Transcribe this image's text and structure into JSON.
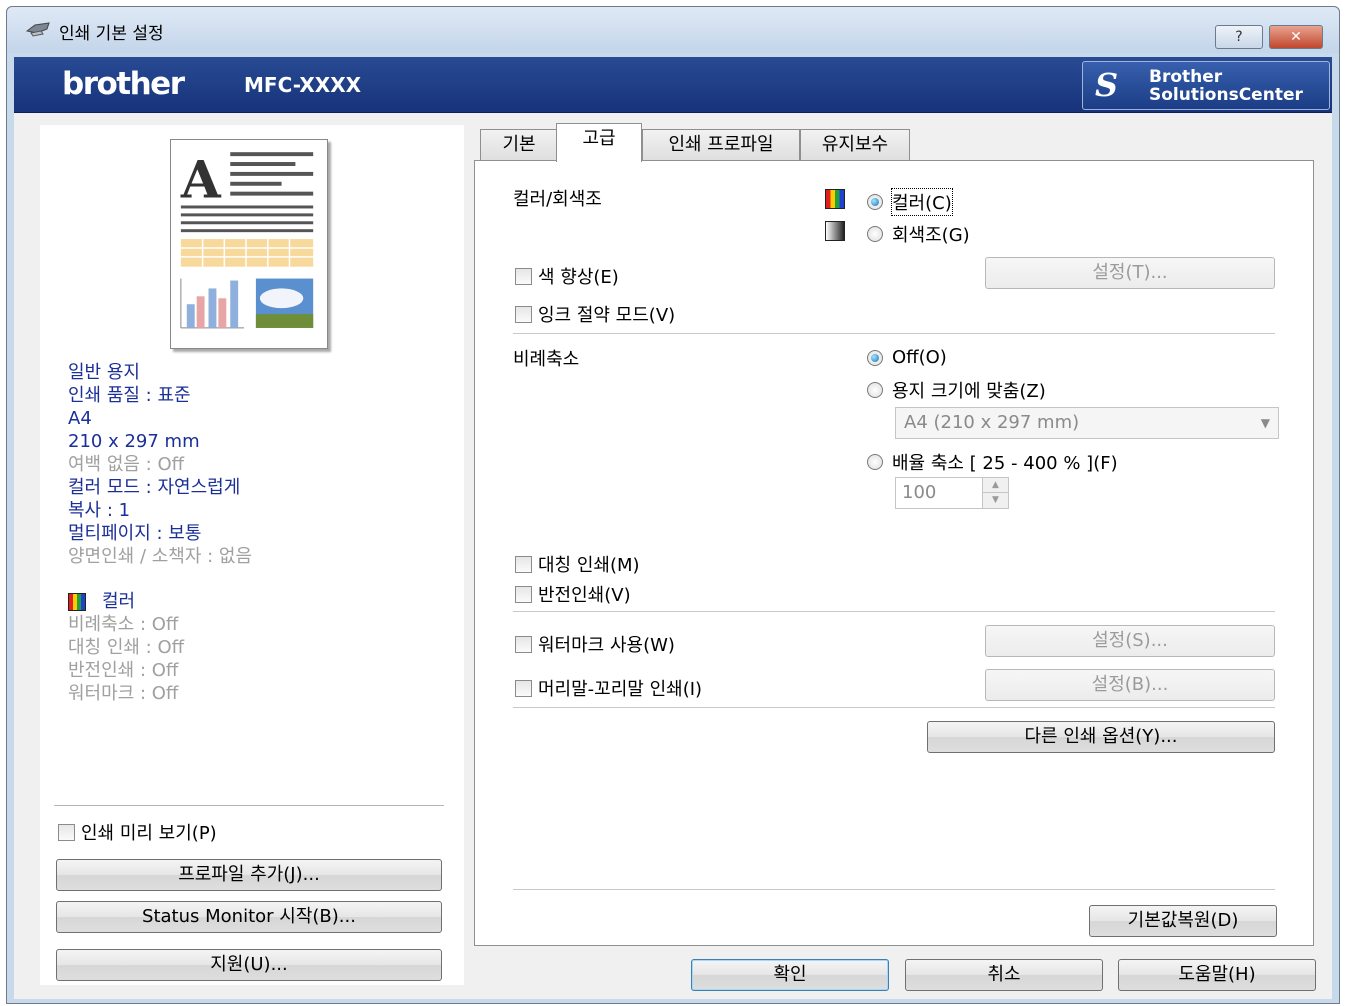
{
  "window": {
    "title": "인쇄 기본 설정",
    "help_btn": "?",
    "close_btn": "✕"
  },
  "brand": {
    "logo": "brother",
    "model": "MFC-XXXX",
    "solutions_line1": "Brother",
    "solutions_line2": "SolutionsCenter"
  },
  "summary": {
    "lines": [
      {
        "text": "일반 용지",
        "style": "blue"
      },
      {
        "text": "인쇄 품질 : 표준",
        "style": "blue"
      },
      {
        "text": "A4",
        "style": "blue"
      },
      {
        "text": "210 x 297 mm",
        "style": "blue"
      },
      {
        "text": "여백 없음 : Off",
        "style": "gray"
      },
      {
        "text": "컬러 모드 : 자연스럽게",
        "style": "blue"
      },
      {
        "text": "복사 : 1",
        "style": "blue"
      },
      {
        "text": "멀티페이지 : 보통",
        "style": "blue"
      },
      {
        "text": "양면인쇄 / 소책자 : 없음",
        "style": "gray"
      }
    ],
    "color_mode": "컬러",
    "status_lines": [
      "비례축소 : Off",
      "대칭 인쇄 : Off",
      "반전인쇄 : Off",
      "워터마크 : Off"
    ]
  },
  "left_controls": {
    "preview_checkbox": "인쇄 미리 보기(P)",
    "add_profile": "프로파일 추가(J)...",
    "status_monitor": "Status Monitor 시작(B)...",
    "support": "지원(U)..."
  },
  "tabs": [
    "기본",
    "고급",
    "인쇄 프로파일",
    "유지보수"
  ],
  "active_tab": "고급",
  "advanced": {
    "color_label": "컬러/회색조",
    "color_option": "컬러(C)",
    "gray_option": "회색조(G)",
    "color_enhance": "색 향상(E)",
    "color_enhance_settings": "설정(T)...",
    "ink_save": "잉크 절약 모드(V)",
    "scaling_label": "비례축소",
    "scaling_off": "Off(O)",
    "scaling_fit": "용지 크기에 맞춤(Z)",
    "paper_size_value": "A4 (210 x 297 mm)",
    "scaling_free": "배율 축소 [ 25 - 400 % ](F)",
    "scale_value": "100",
    "mirror": "대칭 인쇄(M)",
    "reverse": "반전인쇄(V)",
    "watermark": "워터마크 사용(W)",
    "watermark_settings": "설정(S)...",
    "header_footer": "머리말-꼬리말 인쇄(I)",
    "header_footer_settings": "설정(B)...",
    "other_options": "다른 인쇄 옵션(Y)...",
    "restore_default": "기본값복원(D)"
  },
  "footer": {
    "ok": "확인",
    "cancel": "취소",
    "help": "도움말(H)"
  }
}
